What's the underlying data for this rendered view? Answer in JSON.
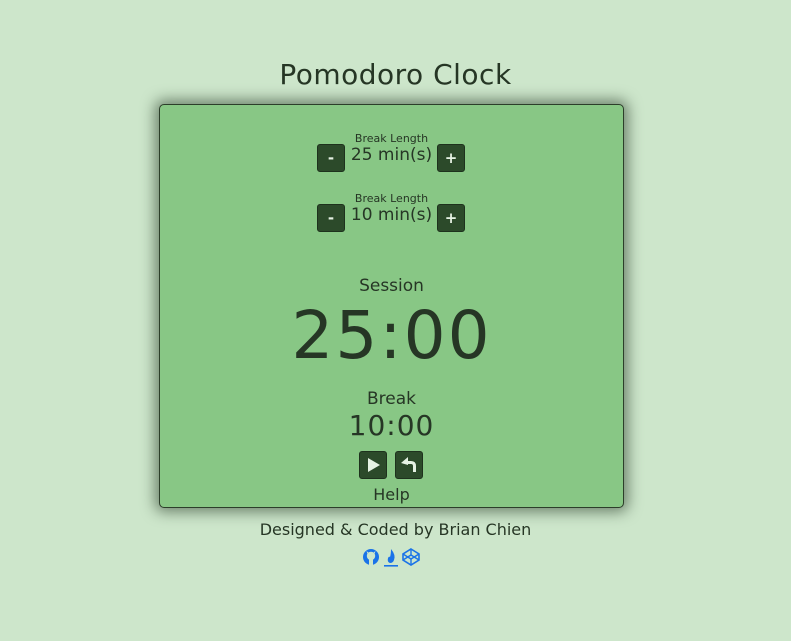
{
  "app": {
    "title": "Pomodoro Clock"
  },
  "settings": [
    {
      "label": "Break Length",
      "value": "25 min(s)",
      "minus_label": "-",
      "plus_label": "+"
    },
    {
      "label": "Break Length",
      "value": "10 min(s)",
      "minus_label": "-",
      "plus_label": "+"
    }
  ],
  "timer": {
    "session_label": "Session",
    "session_time": "25:00",
    "break_label": "Break",
    "break_time": "10:00"
  },
  "controls": {
    "play_icon": "play-icon",
    "reset_icon": "undo-icon",
    "help_label": "Help"
  },
  "footer": {
    "credit": "Designed & Coded by Brian Chien",
    "links": [
      {
        "icon": "github-icon"
      },
      {
        "icon": "freecodecamp-icon"
      },
      {
        "icon": "codepen-icon"
      }
    ]
  },
  "colors": {
    "background": "#cde6cb",
    "card": "#88c785",
    "button": "#2c4a2a",
    "text": "#263625",
    "link": "#1a73e8"
  }
}
